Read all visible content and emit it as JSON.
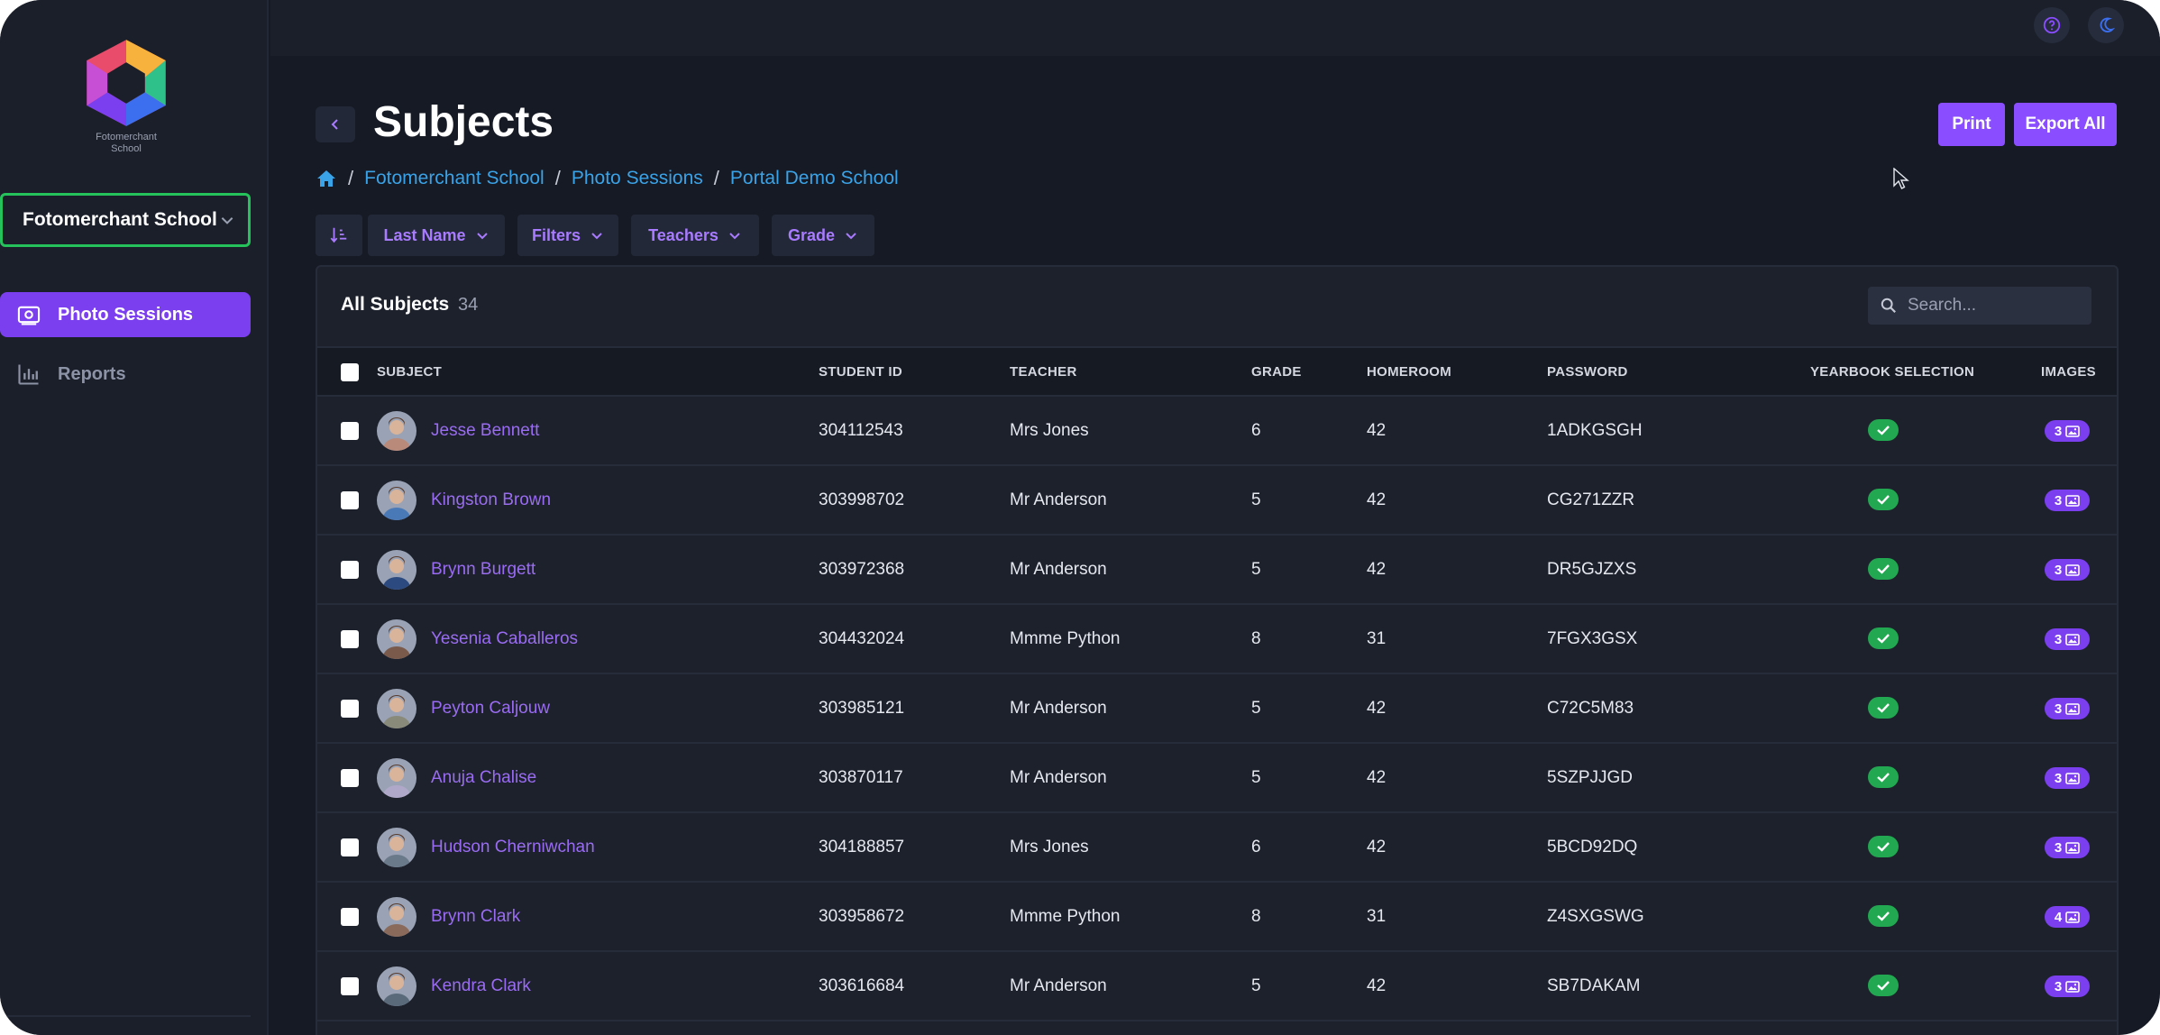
{
  "sidebar": {
    "logo_text_line1": "Fotomerchant",
    "logo_text_line2": "School",
    "school_select": "Fotomerchant School",
    "nav": [
      {
        "label": "Photo Sessions",
        "icon": "camera-icon",
        "active": true
      },
      {
        "label": "Reports",
        "icon": "bar-chart-icon",
        "active": false
      }
    ]
  },
  "topbar": {
    "icons": [
      "help-icon",
      "dark-mode-icon"
    ]
  },
  "header": {
    "title": "Subjects",
    "print_label": "Print",
    "export_label": "Export All",
    "breadcrumb": [
      "Fotomerchant School",
      "Photo Sessions",
      "Portal Demo School"
    ]
  },
  "filters": {
    "sort": "Last Name",
    "filters": "Filters",
    "teachers": "Teachers",
    "grade": "Grade"
  },
  "table": {
    "title": "All Subjects",
    "count": "34",
    "search_placeholder": "Search...",
    "columns": {
      "subject": "SUBJECT",
      "student_id": "STUDENT ID",
      "teacher": "TEACHER",
      "grade": "GRADE",
      "homeroom": "HOMEROOM",
      "password": "PASSWORD",
      "yearbook": "YEARBOOK SELECTION",
      "images": "IMAGES"
    },
    "rows": [
      {
        "name": "Jesse Bennett",
        "student_id": "304112543",
        "teacher": "Mrs Jones",
        "grade": "6",
        "homeroom": "42",
        "password": "1ADKGSGH",
        "yearbook": true,
        "images": "3"
      },
      {
        "name": "Kingston Brown",
        "student_id": "303998702",
        "teacher": "Mr Anderson",
        "grade": "5",
        "homeroom": "42",
        "password": "CG271ZZR",
        "yearbook": true,
        "images": "3"
      },
      {
        "name": "Brynn Burgett",
        "student_id": "303972368",
        "teacher": "Mr Anderson",
        "grade": "5",
        "homeroom": "42",
        "password": "DR5GJZXS",
        "yearbook": true,
        "images": "3"
      },
      {
        "name": "Yesenia Caballeros",
        "student_id": "304432024",
        "teacher": "Mmme Python",
        "grade": "8",
        "homeroom": "31",
        "password": "7FGX3GSX",
        "yearbook": true,
        "images": "3"
      },
      {
        "name": "Peyton Caljouw",
        "student_id": "303985121",
        "teacher": "Mr Anderson",
        "grade": "5",
        "homeroom": "42",
        "password": "C72C5M83",
        "yearbook": true,
        "images": "3"
      },
      {
        "name": "Anuja Chalise",
        "student_id": "303870117",
        "teacher": "Mr Anderson",
        "grade": "5",
        "homeroom": "42",
        "password": "5SZPJJGD",
        "yearbook": true,
        "images": "3"
      },
      {
        "name": "Hudson Cherniwchan",
        "student_id": "304188857",
        "teacher": "Mrs Jones",
        "grade": "6",
        "homeroom": "42",
        "password": "5BCD92DQ",
        "yearbook": true,
        "images": "3"
      },
      {
        "name": "Brynn Clark",
        "student_id": "303958672",
        "teacher": "Mmme Python",
        "grade": "8",
        "homeroom": "31",
        "password": "Z4SXGSWG",
        "yearbook": true,
        "images": "4"
      },
      {
        "name": "Kendra Clark",
        "student_id": "303616684",
        "teacher": "Mr Anderson",
        "grade": "5",
        "homeroom": "42",
        "password": "SB7DAKAM",
        "yearbook": true,
        "images": "3"
      }
    ]
  },
  "colors": {
    "accent": "#8a4dff",
    "link": "#3aa3e8",
    "name_link": "#9a6cf2",
    "success": "#22a851",
    "focus_border": "#25c15b",
    "avatar_palette": [
      "#b98a7a",
      "#4a79b8",
      "#2c4a80",
      "#7a5a4a",
      "#8a8a7a",
      "#b0a8c8",
      "#6a7a8a",
      "#8a6a5a",
      "#5a6a7a"
    ]
  }
}
